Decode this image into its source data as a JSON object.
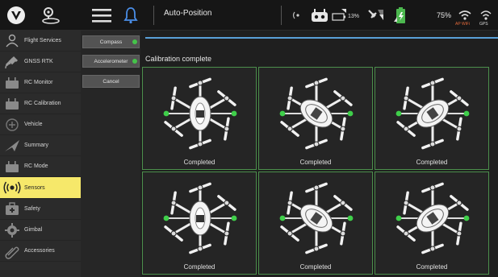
{
  "topbar": {
    "flight_mode": "Auto-Position",
    "battery_pct": "75%",
    "rc_battery_pct": "13%",
    "wifi_caption": "AP WiFi",
    "gps_caption": "GPS"
  },
  "sidebar": {
    "items": [
      {
        "label": "Flight Services",
        "icon": "flight-services-icon"
      },
      {
        "label": "GNSS RTK",
        "icon": "gnss-rtk-icon"
      },
      {
        "label": "RC Monitor",
        "icon": "rc-monitor-icon"
      },
      {
        "label": "RC Calibration",
        "icon": "rc-calibration-icon"
      },
      {
        "label": "Vehicle",
        "icon": "vehicle-icon"
      },
      {
        "label": "Summary",
        "icon": "summary-icon"
      },
      {
        "label": "RC Mode",
        "icon": "rc-mode-icon"
      },
      {
        "label": "Sensors",
        "icon": "sensors-icon",
        "active": true
      },
      {
        "label": "Safety",
        "icon": "safety-icon"
      },
      {
        "label": "Gimbal",
        "icon": "gimbal-icon"
      },
      {
        "label": "Accessories",
        "icon": "accessories-icon"
      }
    ]
  },
  "submenu": {
    "compass": "Compass",
    "accelerometer": "Accelerometer",
    "cancel": "Cancel"
  },
  "main": {
    "status": "Calibration complete",
    "cells": [
      "Completed",
      "Completed",
      "Completed",
      "Completed",
      "Completed",
      "Completed"
    ]
  },
  "colors": {
    "accent_yellow": "#f6e86a",
    "status_green": "#45c34a",
    "progress_blue": "#5aa0d8",
    "cell_border": "#4c8f4c"
  }
}
